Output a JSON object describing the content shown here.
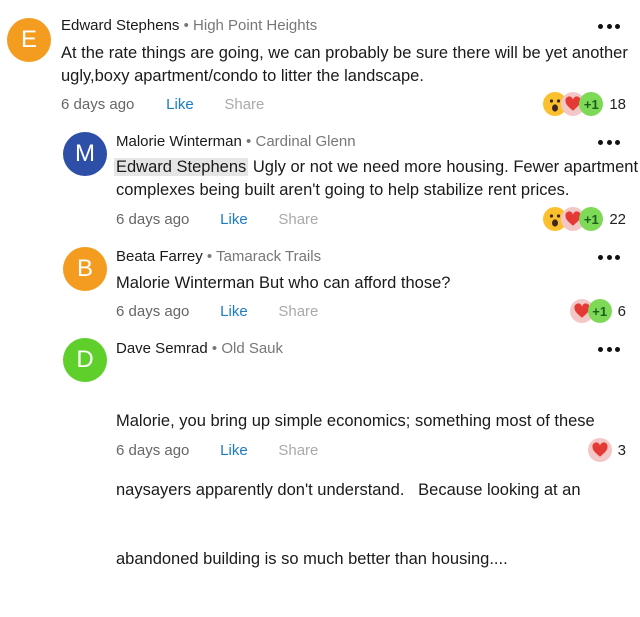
{
  "comments": [
    {
      "initial": "E",
      "avatar_color": "#f39c1f",
      "name": "Edward Stephens",
      "separator": "•",
      "neighborhood": "High Point Heights",
      "line1": "At the rate things are going, we can probably be sure there will be yet another",
      "line2": "ugly,boxy apartment/condo to litter the landscape.",
      "time": "6 days ago",
      "like": "Like",
      "share": "Share",
      "reactions": [
        "wow",
        "love",
        "plus-one"
      ],
      "plus_label": "+1",
      "count": "18"
    },
    {
      "initial": "M",
      "avatar_color": "#2d4fa8",
      "name": "Malorie Winterman",
      "separator": "•",
      "neighborhood": "Cardinal Glenn",
      "mention": "Edward Stephens",
      "line1_rest": " Ugly or not we need more housing. Fewer apartment",
      "line2": "complexes being built aren't going to help stabilize rent prices.",
      "time": "6 days ago",
      "like": "Like",
      "share": "Share",
      "reactions": [
        "wow",
        "love",
        "plus-one"
      ],
      "plus_label": "+1",
      "count": "22"
    },
    {
      "initial": "B",
      "avatar_color": "#f39c1f",
      "name": "Beata Farrey",
      "separator": "•",
      "neighborhood": "Tamarack Trails",
      "line1": "Malorie Winterman But who can afford those?",
      "time": "6 days ago",
      "like": "Like",
      "share": "Share",
      "reactions": [
        "love",
        "plus-one"
      ],
      "plus_label": "+1",
      "count": "6"
    },
    {
      "initial": "D",
      "avatar_color": "#5fcf2c",
      "name": "Dave Semrad",
      "separator": "•",
      "neighborhood": "Old Sauk",
      "line1": "Malorie, you bring up simple economics; something most of these",
      "line2": "naysayers apparently don't understand.   Because looking at an",
      "line3": "abandoned building is so much better than housing....",
      "time": "6 days ago",
      "like": "Like",
      "share": "Share",
      "reactions": [
        "love"
      ],
      "count": "3"
    }
  ],
  "colors": {
    "like_link": "#1a7bc7",
    "muted": "#777777"
  }
}
